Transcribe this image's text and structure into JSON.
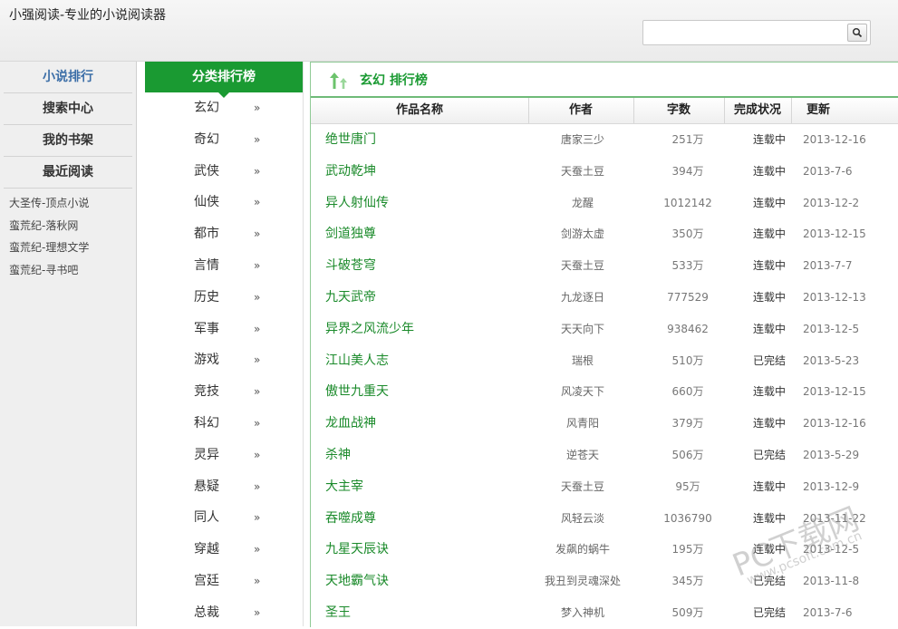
{
  "app": {
    "title": "小强阅读-专业的小说阅读器"
  },
  "search": {
    "value": "",
    "placeholder": ""
  },
  "sidebar": {
    "nav": [
      {
        "label": "小说排行",
        "active": true
      },
      {
        "label": "搜索中心",
        "active": false
      },
      {
        "label": "我的书架",
        "active": false
      },
      {
        "label": "最近阅读",
        "active": false
      }
    ],
    "recent": [
      "大圣传-顶点小说",
      "蛮荒纪-落秋网",
      "蛮荒纪-理想文学",
      "蛮荒纪-寻书吧"
    ]
  },
  "categories": {
    "header": "分类排行榜",
    "arrow": "»",
    "items": [
      "玄幻",
      "奇幻",
      "武侠",
      "仙侠",
      "都市",
      "言情",
      "历史",
      "军事",
      "游戏",
      "竞技",
      "科幻",
      "灵异",
      "悬疑",
      "同人",
      "穿越",
      "宫廷",
      "总裁"
    ]
  },
  "main": {
    "title": "玄幻 排行榜",
    "columns": {
      "name": "作品名称",
      "author": "作者",
      "words": "字数",
      "status": "完成状况",
      "updated": "更新"
    },
    "rows": [
      {
        "name": "绝世唐门",
        "author": "唐家三少",
        "words": "251万",
        "status": "连载中",
        "updated": "2013-12-16"
      },
      {
        "name": "武动乾坤",
        "author": "天蚕土豆",
        "words": "394万",
        "status": "连载中",
        "updated": "2013-7-6"
      },
      {
        "name": "异人射仙传",
        "author": "龙醒",
        "words": "1012142",
        "status": "连载中",
        "updated": "2013-12-2"
      },
      {
        "name": "剑道独尊",
        "author": "剑游太虚",
        "words": "350万",
        "status": "连载中",
        "updated": "2013-12-15"
      },
      {
        "name": "斗破苍穹",
        "author": "天蚕土豆",
        "words": "533万",
        "status": "连载中",
        "updated": "2013-7-7"
      },
      {
        "name": "九天武帝",
        "author": "九龙逐日",
        "words": "777529",
        "status": "连载中",
        "updated": "2013-12-13"
      },
      {
        "name": "异界之风流少年",
        "author": "天天向下",
        "words": "938462",
        "status": "连载中",
        "updated": "2013-12-5"
      },
      {
        "name": "江山美人志",
        "author": "瑞根",
        "words": "510万",
        "status": "已完结",
        "updated": "2013-5-23"
      },
      {
        "name": "傲世九重天",
        "author": "风凌天下",
        "words": "660万",
        "status": "连载中",
        "updated": "2013-12-15"
      },
      {
        "name": "龙血战神",
        "author": "风青阳",
        "words": "379万",
        "status": "连载中",
        "updated": "2013-12-16"
      },
      {
        "name": "杀神",
        "author": "逆苍天",
        "words": "506万",
        "status": "已完结",
        "updated": "2013-5-29"
      },
      {
        "name": "大主宰",
        "author": "天蚕土豆",
        "words": "95万",
        "status": "连载中",
        "updated": "2013-12-9"
      },
      {
        "name": "吞噬成尊",
        "author": "风轻云淡",
        "words": "1036790",
        "status": "连载中",
        "updated": "2013-11-22"
      },
      {
        "name": "九星天辰诀",
        "author": "发飙的蜗牛",
        "words": "195万",
        "status": "连载中",
        "updated": "2013-12-5"
      },
      {
        "name": "天地霸气诀",
        "author": "我丑到灵魂深处",
        "words": "345万",
        "status": "已完结",
        "updated": "2013-11-8"
      },
      {
        "name": "圣王",
        "author": "梦入神机",
        "words": "509万",
        "status": "已完结",
        "updated": "2013-7-6"
      }
    ]
  },
  "watermark": {
    "text": "PC下载网",
    "url": "www.pcsoft.com.cn"
  },
  "colors": {
    "accent": "#1a9a32",
    "link": "#1a8a2a",
    "nav_active": "#3d6fa8"
  }
}
